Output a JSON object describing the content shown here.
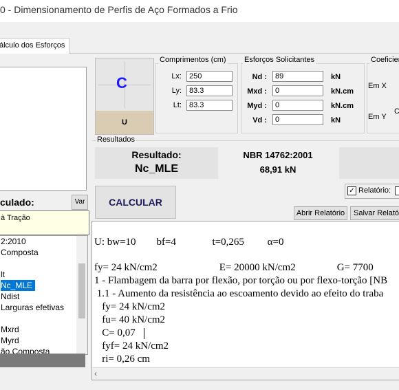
{
  "window": {
    "title": "0 - Dimensionamento de Perfis de Aço Formados a Frio"
  },
  "tabs": {
    "active": "álculo dos Esforços"
  },
  "profile": {
    "glyph": "C",
    "type_label": "U"
  },
  "lengths": {
    "title": "Comprimentos (cm)",
    "rows": [
      {
        "label": "Lx:",
        "value": "250"
      },
      {
        "label": "Ly:",
        "value": "83.3"
      },
      {
        "label": "Lt:",
        "value": "83.3"
      }
    ]
  },
  "forces": {
    "title": "Esforços Solicitantes",
    "rows": [
      {
        "label": "Nd :",
        "value": "89",
        "unit": "kN"
      },
      {
        "label": "Mxd :",
        "value": "0",
        "unit": "kN.cm"
      },
      {
        "label": "Myd :",
        "value": "0",
        "unit": "kN.cm"
      },
      {
        "label": "Vd :",
        "value": "0",
        "unit": "kN"
      }
    ]
  },
  "coef": {
    "title": "Coeficier",
    "em_x": "Em X",
    "em_y": "Em Y",
    "c": "C"
  },
  "results": {
    "title": "Resultados",
    "result_label": "Resultado:",
    "result_value": "Nc_MLE",
    "norm_label": "NBR 14762:2001",
    "norm_value": "68,91 kN"
  },
  "calc_header": {
    "label": "culado:",
    "var_button": "Var"
  },
  "tracao": "à Tração",
  "buttons": {
    "calcular": "CALCULAR",
    "abrir": "Abrir Relatório",
    "salvar": "Salvar Relatóri"
  },
  "relatorio_checkbox": {
    "label": "Relatório:",
    "checked": true
  },
  "left_list": {
    "items": [
      "2:2010",
      "Composta",
      "",
      "lt",
      "Nc_MLE",
      "Ndist",
      "Larguras efetivas",
      "",
      "Mxrd",
      "Myrd",
      "ão Composta"
    ],
    "selected_index": 4
  },
  "report": {
    "lines": [
      "",
      "U: bw=10        bf=4              t=0,265         α=0",
      "",
      "fy= 24 kN/cm2                        E= 20000 kN/cm2                G= 7700",
      "1 - Flambagem da barra por flexão, por torção ou por flexo-torção [NB",
      " 1.1 - Aumento da resistência ao escoamento devido ao efeito do traba",
      "   fy= 24 kN/cm2",
      "   fu= 40 kN/cm2",
      "   C= 0,07",
      "   fyf= 24 kN/cm2",
      "   ri= 0,26 cm"
    ]
  }
}
